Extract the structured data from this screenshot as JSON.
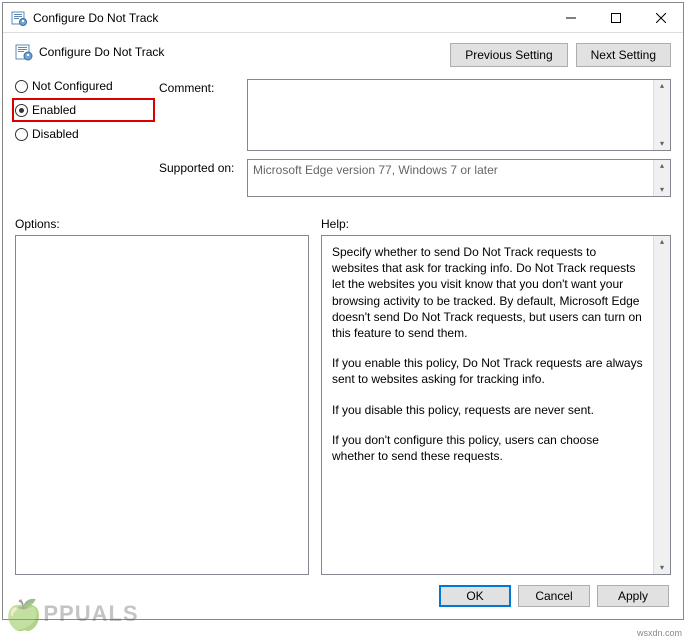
{
  "window": {
    "title": "Configure Do Not Track"
  },
  "header": {
    "title": "Configure Do Not Track",
    "prev_label": "Previous Setting",
    "next_label": "Next Setting"
  },
  "radio": {
    "not_configured": "Not Configured",
    "enabled": "Enabled",
    "disabled": "Disabled"
  },
  "fields": {
    "comment_label": "Comment:",
    "comment_value": "",
    "supported_label": "Supported on:",
    "supported_value": "Microsoft Edge version 77, Windows 7 or later"
  },
  "labels": {
    "options": "Options:",
    "help": "Help:"
  },
  "help": {
    "p1": "Specify whether to send Do Not Track requests to websites that ask for tracking info. Do Not Track requests let the websites you visit know that you don't want your browsing activity to be tracked. By default, Microsoft Edge doesn't send Do Not Track requests, but users can turn on this feature to send them.",
    "p2": "If you enable this policy, Do Not Track requests are always sent to websites asking for tracking info.",
    "p3": "If you disable this policy, requests are never sent.",
    "p4": "If you don't configure this policy, users can choose whether to send these requests."
  },
  "buttons": {
    "ok": "OK",
    "cancel": "Cancel",
    "apply": "Apply"
  },
  "watermark": {
    "site": "wsxdn.com",
    "brand": "PPUALS"
  }
}
